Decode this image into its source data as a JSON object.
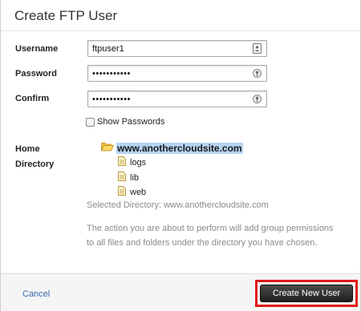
{
  "dialog": {
    "title": "Create FTP User"
  },
  "form": {
    "username_label": "Username",
    "username_value": "ftpuser1",
    "password_label": "Password",
    "password_value": "•••••••••••",
    "confirm_label": "Confirm",
    "confirm_value": "•••••••••••",
    "show_passwords_label": "Show Passwords",
    "show_passwords_checked": false,
    "home_label_line1": "Home",
    "home_label_line2": "Directory"
  },
  "tree": {
    "root": "www.anothercloudsite.com",
    "children": [
      "logs",
      "lib",
      "web"
    ]
  },
  "selected_directory": "Selected Directory: www.anothercloudsite.com",
  "notice": "The action you are about to perform will add group permissions to all files and folders under the directory you have chosen.",
  "footer": {
    "cancel_label": "Cancel",
    "primary_label": "Create New User"
  },
  "colors": {
    "accent_highlight": "#e01b1b",
    "selection": "#b5d3f3",
    "link": "#3366aa",
    "primary_button": "#2a2a2a"
  },
  "icons": {
    "username_field": "contact-card-icon",
    "password_field": "password-key-icon",
    "confirm_field": "password-key-icon",
    "tree_root": "folder-open-icon",
    "tree_child": "file-icon"
  }
}
